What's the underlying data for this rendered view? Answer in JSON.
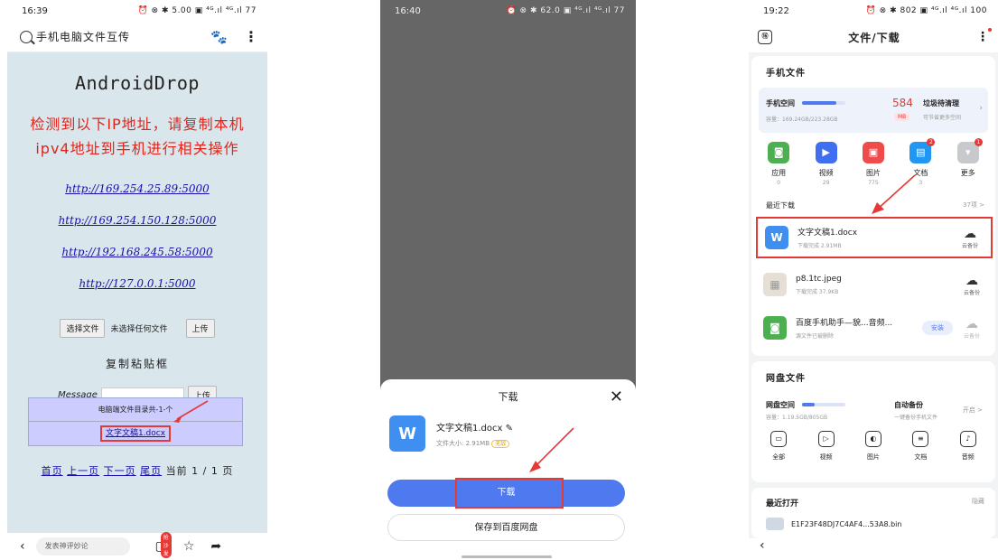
{
  "phone1": {
    "status": {
      "time": "16:39",
      "icons": "⏰ ⊗ ✱ 5.00 ▣ ⁴ᴳ.ıl ⁴ᴳ.ıl 77"
    },
    "search_title": "手机电脑文件互传",
    "app_title": "AndroidDrop",
    "warning": "检测到以下IP地址，请复制本机ipv4地址到手机进行相关操作",
    "links": [
      "http://169.254.25.89:5000",
      "http://169.254.150.128:5000",
      "http://192.168.245.58:5000",
      "http://127.0.0.1:5000"
    ],
    "choose_file": "选择文件",
    "no_file": "未选择任何文件",
    "upload": "上传",
    "clipboard_title": "复制粘贴框",
    "message_label": "Message",
    "upload2": "上传",
    "list_header": "电脑端文件目录共-1-个",
    "list_file": "文字文稿1.docx",
    "pager": {
      "first": "首页",
      "prev": "上一页",
      "next": "下一页",
      "last": "尾页",
      "current": "当前 1 / 1 页"
    },
    "comment_placeholder": "发表神评妙论",
    "badge": "抢沙发"
  },
  "phone2": {
    "status": {
      "time": "16:40",
      "icons": "⏰ ⊗ ✱ 62.0 ▣ ⁴ᴳ.ıl ⁴ᴳ.ıl 77"
    },
    "sheet_title": "下载",
    "file_name": "文字文稿1.docx",
    "file_size": "文件大小: 2.91MB",
    "size_tag": "无敌",
    "download_btn": "下载",
    "save_btn": "保存到百度网盘"
  },
  "phone3": {
    "status": {
      "time": "19:22",
      "icons": "⏰ ⊗ ✱ 802 ▣ ⁴ᴳ.ıl ⁴ᴳ.ıl 100"
    },
    "header_title": "文件/下载",
    "section_phone": "手机文件",
    "storage": {
      "label": "手机空间",
      "capacity": "容量：169.24GB/223.28GB",
      "num": "584",
      "unit": "MB",
      "junk": "垃圾待清理",
      "junk_sub": "可节省更多空间"
    },
    "categories": [
      {
        "label": "应用",
        "count": "0",
        "color": "#4caf50",
        "glyph": "◙",
        "badge": ""
      },
      {
        "label": "视频",
        "count": "29",
        "color": "#3f6ff0",
        "glyph": "▶",
        "badge": ""
      },
      {
        "label": "图片",
        "count": "775",
        "color": "#ef4b4b",
        "glyph": "▣",
        "badge": ""
      },
      {
        "label": "文档",
        "count": "3",
        "color": "#2196f3",
        "glyph": "▤",
        "badge": "2"
      },
      {
        "label": "更多",
        "count": "",
        "color": "#c7c9cc",
        "glyph": "▾",
        "badge": "1"
      }
    ],
    "recent_title": "最近下载",
    "recent_more": "37项 >",
    "recent": [
      {
        "name": "文字文稿1.docx",
        "sub": "下载完成  2.91MB",
        "color": "#3f8ff0",
        "glyph": "W",
        "action": "云备份"
      },
      {
        "name": "p8.1tc.jpeg",
        "sub": "下载完成  37.9KB",
        "color": "#d9d0c6",
        "glyph": "▦",
        "action": "云备份"
      },
      {
        "name": "百度手机助手—貌...音频...",
        "sub": "源文件已被删除",
        "color": "#4caf50",
        "glyph": "◙",
        "action": "云备份",
        "install": "安装"
      }
    ],
    "section_pan": "网盘文件",
    "pan": {
      "label": "网盘空间",
      "capacity": "容量：1.19.5GB/805GB",
      "auto": "自动备份",
      "auto_sub": "一键备份手机文件",
      "toggle": "开启 >"
    },
    "tools": [
      {
        "label": "全部",
        "glyph": "▭"
      },
      {
        "label": "视频",
        "glyph": "▷"
      },
      {
        "label": "图片",
        "glyph": "◐"
      },
      {
        "label": "文档",
        "glyph": "≡"
      },
      {
        "label": "音频",
        "glyph": "♪"
      }
    ],
    "recent_open": "最近打开",
    "hide": "隐藏",
    "open_file": "E1F23F48DJ7C4AF4...53A8.bin"
  }
}
